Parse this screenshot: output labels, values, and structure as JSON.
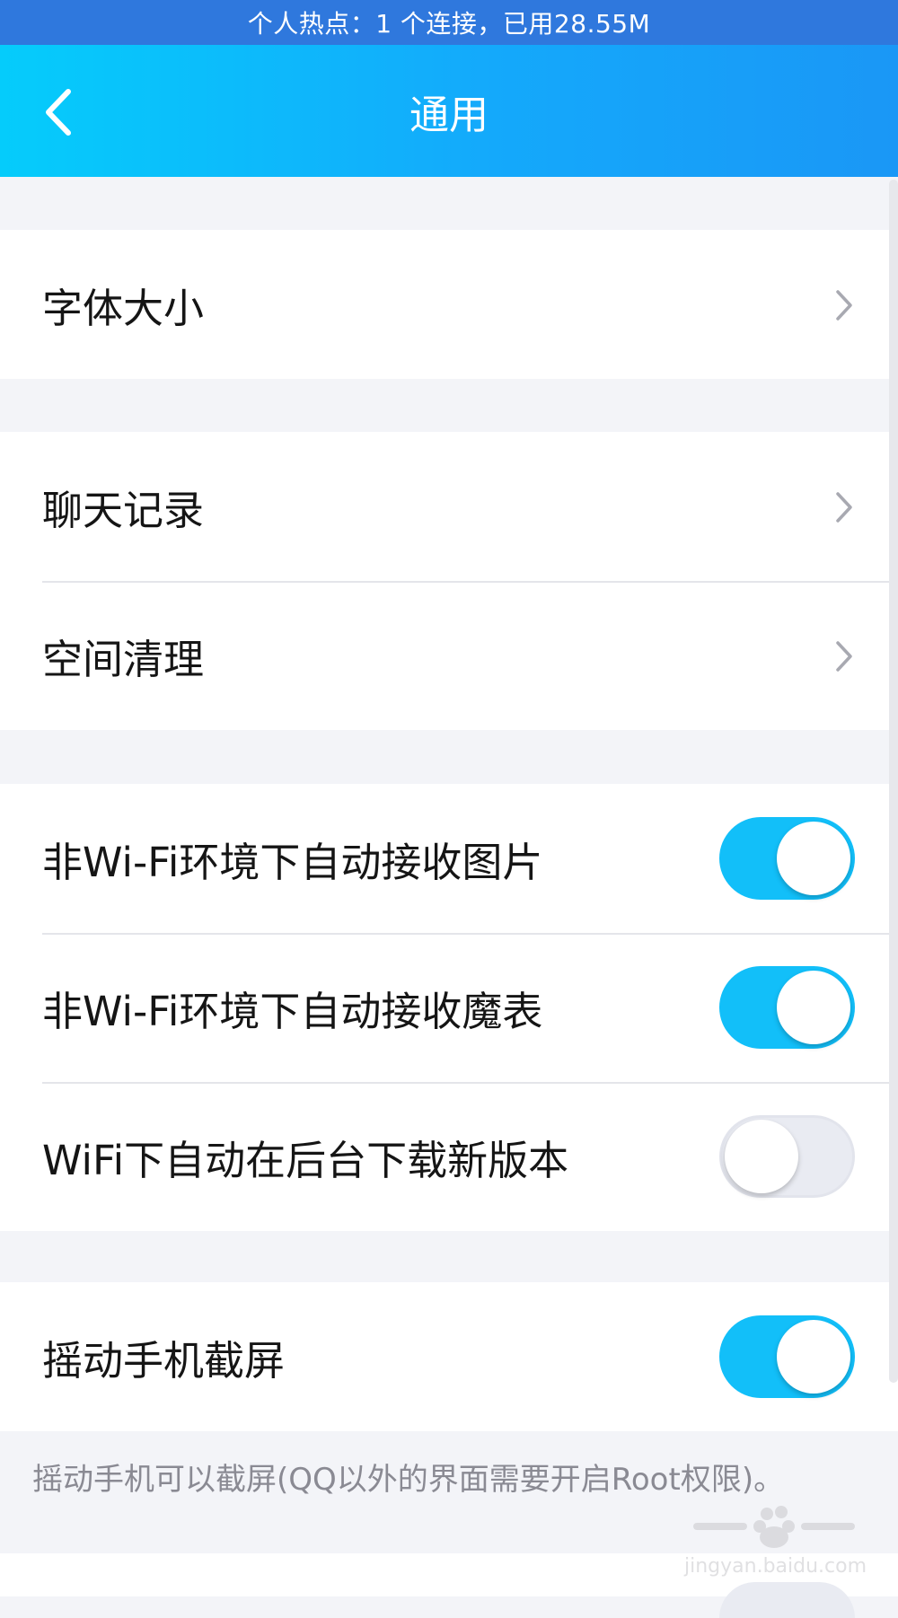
{
  "status_bar": {
    "text": "个人热点：1 个连接，已用28.55M"
  },
  "header": {
    "title": "通用",
    "back_icon": "chevron-left-icon"
  },
  "sections": {
    "font": {
      "items": [
        {
          "label": "字体大小",
          "icon": "chevron-right-icon"
        }
      ]
    },
    "storage": {
      "items": [
        {
          "label": "聊天记录",
          "icon": "chevron-right-icon"
        },
        {
          "label": "空间清理",
          "icon": "chevron-right-icon"
        }
      ]
    },
    "network": {
      "items": [
        {
          "label": "非Wi-Fi环境下自动接收图片",
          "toggle": true
        },
        {
          "label": "非Wi-Fi环境下自动接收魔表",
          "toggle": true
        },
        {
          "label": "WiFi下自动在后台下载新版本",
          "toggle": false
        }
      ]
    },
    "shake": {
      "items": [
        {
          "label": "摇动手机截屏",
          "toggle": true
        }
      ],
      "footnote": "摇动手机可以截屏(QQ以外的界面需要开启Root权限)。"
    }
  },
  "watermark": {
    "text": "jingyan.baidu.com"
  },
  "colors": {
    "status_bar": "#2f78dd",
    "header_gradient_start": "#05ccfb",
    "header_gradient_end": "#1a97f6",
    "toggle_on": "#12bff9",
    "toggle_off": "#e9ebf2",
    "background": "#f3f4f8"
  }
}
